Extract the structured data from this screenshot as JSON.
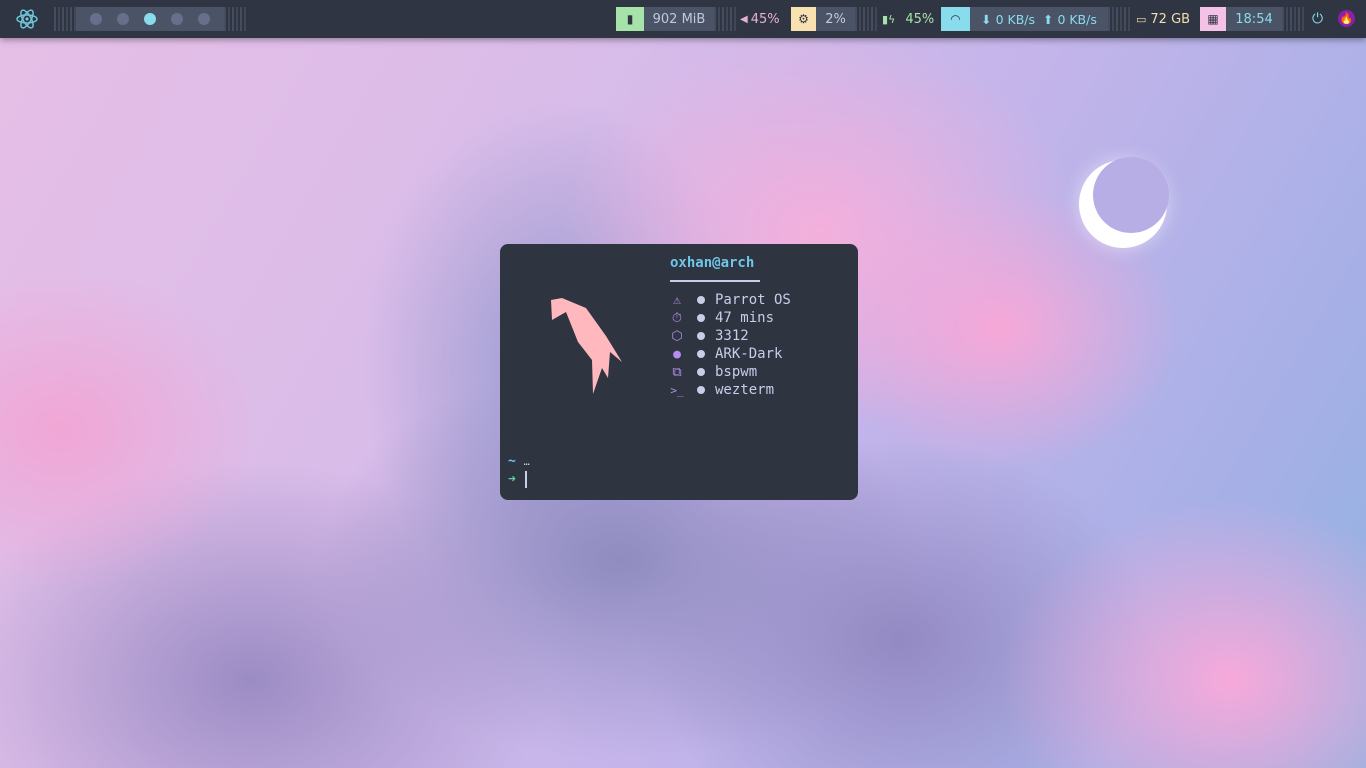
{
  "topbar": {
    "launcher_icon": "atom-icon",
    "workspaces": [
      {
        "active": false
      },
      {
        "active": false
      },
      {
        "active": true
      },
      {
        "active": false
      },
      {
        "active": false
      }
    ],
    "memory": {
      "icon": "memory-chip-icon",
      "value": "902 MiB",
      "color": "#a6e3a9"
    },
    "volume": {
      "icon": "speaker-icon",
      "value": "45%"
    },
    "cpu": {
      "icon": "cpu-icon",
      "value": "2%",
      "color": "#f9e2af"
    },
    "battery": {
      "icon": "battery-charging-icon",
      "value": "45%"
    },
    "network": {
      "icon": "wifi-icon",
      "download": "0 KB/s",
      "upload": "0 KB/s",
      "color": "#89dceb"
    },
    "disk": {
      "icon": "drive-icon",
      "value": "72 GB"
    },
    "clock": {
      "icon": "calendar-clock-icon",
      "value": "18:54",
      "color": "#f5c2e7"
    },
    "power_icon": "power-icon",
    "menu_icon": "firefox-flame-icon"
  },
  "terminal": {
    "user_host": "oxhan@arch",
    "logo": "parrot-logo",
    "info": [
      {
        "icon": "linux-icon",
        "value": "Parrot OS"
      },
      {
        "icon": "timer-icon",
        "value": "47 mins"
      },
      {
        "icon": "package-icon",
        "value": "3312"
      },
      {
        "icon": "palette-icon",
        "value": "ARK-Dark"
      },
      {
        "icon": "windows-icon",
        "value": "bspwm"
      },
      {
        "icon": "terminal-icon",
        "value": "wezterm"
      }
    ],
    "cwd": "~",
    "cwd_suffix": "…",
    "prompt": "➜"
  }
}
